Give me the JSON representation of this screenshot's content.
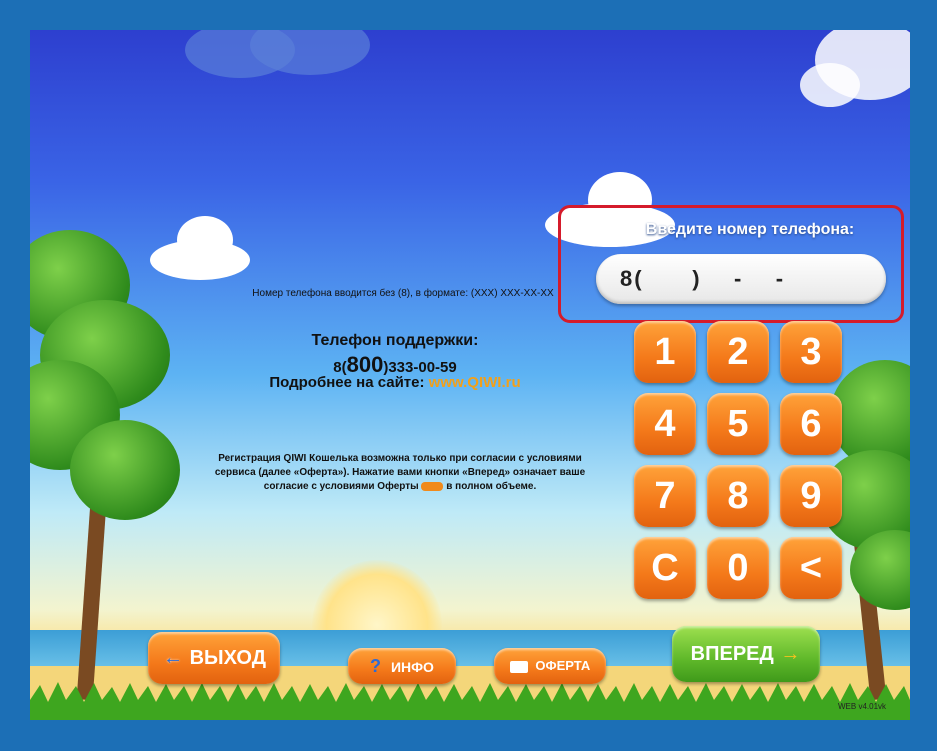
{
  "phone_entry": {
    "title": "Введите номер телефона:",
    "value": "8(      )    -    -"
  },
  "hint": "Номер телефона вводится без (8), в формате: (XXX) XXX-XX-XX",
  "support": {
    "title": "Телефон поддержки:",
    "prefix": "8(",
    "code": "800",
    "number": ")333-00-59"
  },
  "site": {
    "label": "Подробнее на сайте:",
    "link": "www.QIWI.ru"
  },
  "legal": {
    "part1": "Регистрация QIWI Кошелька возможна только при согласии с условиями сервиса (далее «Оферта»). Нажатие вами кнопки «Вперед» означает ваше согласие с условиями Оферты",
    "part2": "в полном объеме."
  },
  "keypad": [
    "1",
    "2",
    "3",
    "4",
    "5",
    "6",
    "7",
    "8",
    "9",
    "C",
    "0",
    "<"
  ],
  "buttons": {
    "exit": "ВЫХОД",
    "info": "ИНФО",
    "oferta": "ОФЕРТА",
    "next": "ВПЕРЕД"
  },
  "version": "WEB v4.01vk",
  "colors": {
    "accent_orange": "#f4791a",
    "accent_green": "#5fb82a",
    "highlight_red": "#d51b2b",
    "frame_blue": "#1c6fb6"
  }
}
